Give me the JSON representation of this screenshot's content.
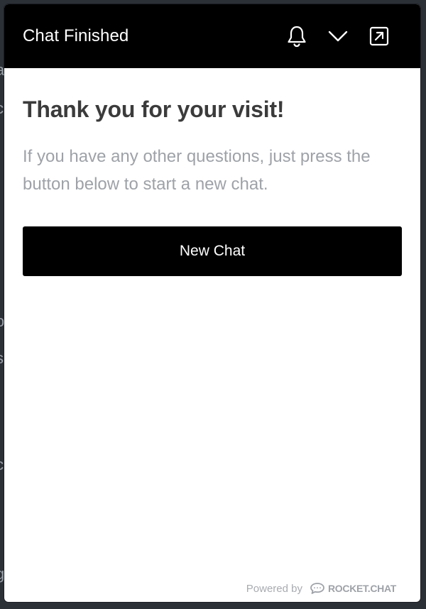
{
  "header": {
    "title": "Chat Finished",
    "icons": [
      "bell-icon",
      "chevron-down-icon",
      "pop-out-icon"
    ]
  },
  "content": {
    "title": "Thank you for your visit!",
    "message": "If you have any other questions, just press the button below to start a new chat.",
    "button_label": "New Chat"
  },
  "footer": {
    "powered_by": "Powered by",
    "brand": "ROCKET.CHAT"
  },
  "colors": {
    "header_bg": "#000000",
    "button_bg": "#000000",
    "title_text": "#3b3b3b",
    "muted_text": "#9ea2a8"
  }
}
